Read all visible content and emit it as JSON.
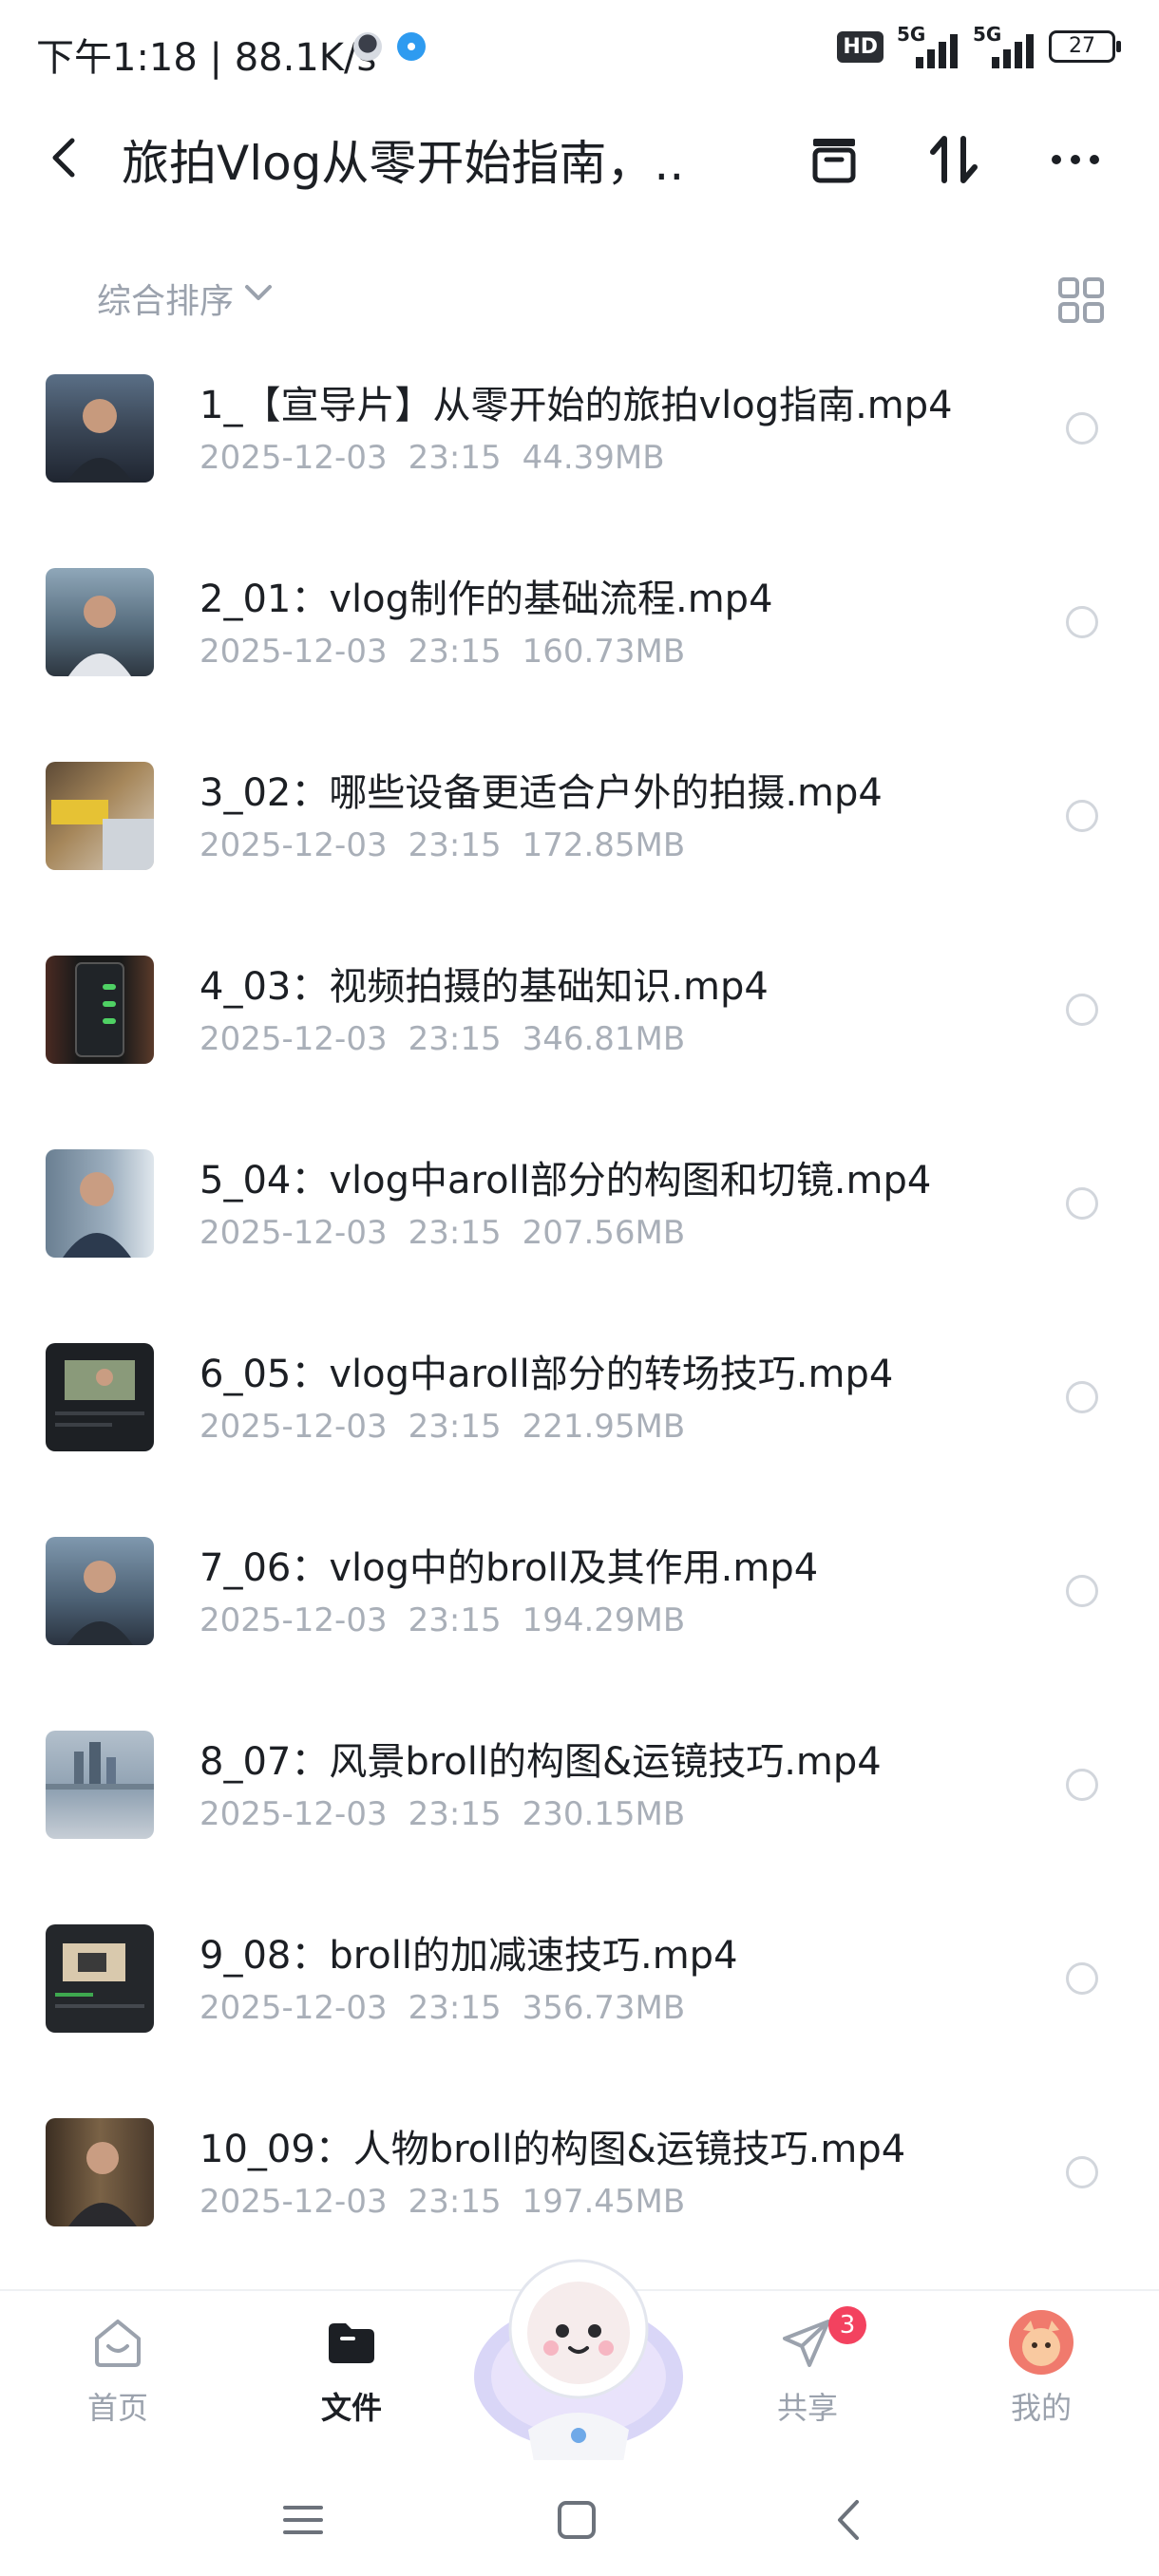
{
  "status_bar": {
    "time": "下午1:18 | 88.1K/s",
    "hd": "HD",
    "signal1": "5G",
    "signal2": "5G",
    "battery": "27"
  },
  "header": {
    "title": "旅拍Vlog从零开始指南，...",
    "icons": [
      "back-arrow-icon",
      "archive-icon",
      "sort-icon",
      "more-icon"
    ]
  },
  "sort": {
    "label": "综合排序"
  },
  "files": [
    {
      "name": "1_【宣导片】从零开始的旅拍vlog指南.mp4",
      "date": "2025-12-03",
      "time": "23:15",
      "size": "44.39MB"
    },
    {
      "name": "2_01：vlog制作的基础流程.mp4",
      "date": "2025-12-03",
      "time": "23:15",
      "size": "160.73MB"
    },
    {
      "name": "3_02：哪些设备更适合户外的拍摄.mp4",
      "date": "2025-12-03",
      "time": "23:15",
      "size": "172.85MB"
    },
    {
      "name": "4_03：视频拍摄的基础知识.mp4",
      "date": "2025-12-03",
      "time": "23:15",
      "size": "346.81MB"
    },
    {
      "name": "5_04：vlog中aroll部分的构图和切镜.mp4",
      "date": "2025-12-03",
      "time": "23:15",
      "size": "207.56MB"
    },
    {
      "name": "6_05：vlog中aroll部分的转场技巧.mp4",
      "date": "2025-12-03",
      "time": "23:15",
      "size": "221.95MB"
    },
    {
      "name": "7_06：vlog中的broll及其作用.mp4",
      "date": "2025-12-03",
      "time": "23:15",
      "size": "194.29MB"
    },
    {
      "name": "8_07：风景broll的构图&运镜技巧.mp4",
      "date": "2025-12-03",
      "time": "23:15",
      "size": "230.15MB"
    },
    {
      "name": "9_08：broll的加减速技巧.mp4",
      "date": "2025-12-03",
      "time": "23:15",
      "size": "356.73MB"
    },
    {
      "name": "10_09：人物broll的构图&运镜技巧.mp4",
      "date": "2025-12-03",
      "time": "23:15",
      "size": "197.45MB"
    }
  ],
  "bottom_nav": {
    "home": "首页",
    "files": "文件",
    "share": "共享",
    "share_badge": "3",
    "me": "我的"
  },
  "colors": {
    "text_primary": "#1c1f24",
    "text_secondary": "#a9afb8",
    "badge": "#f3425f"
  }
}
